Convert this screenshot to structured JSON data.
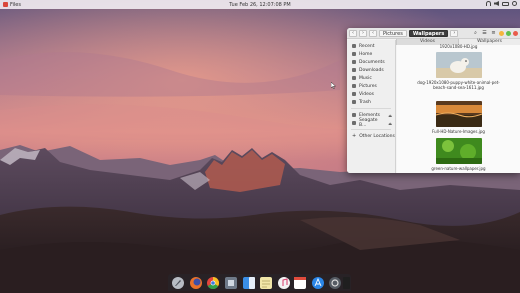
{
  "topbar": {
    "app_name": "Files",
    "clock": "Tue Feb 26,  12:07:08 PM"
  },
  "file_manager": {
    "nav": {
      "back": "‹",
      "forward": "›",
      "up": "‹"
    },
    "breadcrumbs": [
      "Pictures",
      "Wallpapers"
    ],
    "breadcrumb_next": "›",
    "tabs": [
      "Videos",
      "Wallpapers"
    ],
    "sidebar": {
      "places": [
        "Recent",
        "Home",
        "Documents",
        "Downloads",
        "Music",
        "Pictures",
        "Videos",
        "Trash"
      ],
      "devices": [
        "Elements",
        "Seagate B..."
      ],
      "other": "Other Locations"
    },
    "files": [
      {
        "name": "1920x1080-HD.jpg"
      },
      {
        "name": "dog-1920x1080-puppy-white-animal-pet-beach-sand-sea-1611.jpg"
      },
      {
        "name": "Full-HD-Nature-Images.jpg"
      },
      {
        "name": "green-nature-wallpaper.jpg"
      }
    ],
    "colors": {
      "accent": "#3d3d3d",
      "min": "#f5b53d",
      "max": "#5fbf4e",
      "close": "#e95c4b"
    }
  },
  "dock": {
    "apps": [
      "launchpad-icon",
      "firefox-icon",
      "chrome-icon",
      "system-prefs-icon",
      "finder-icon",
      "notes-icon",
      "itunes-icon",
      "calendar-icon",
      "app-store-icon",
      "settings-icon",
      "terminal-icon"
    ]
  }
}
